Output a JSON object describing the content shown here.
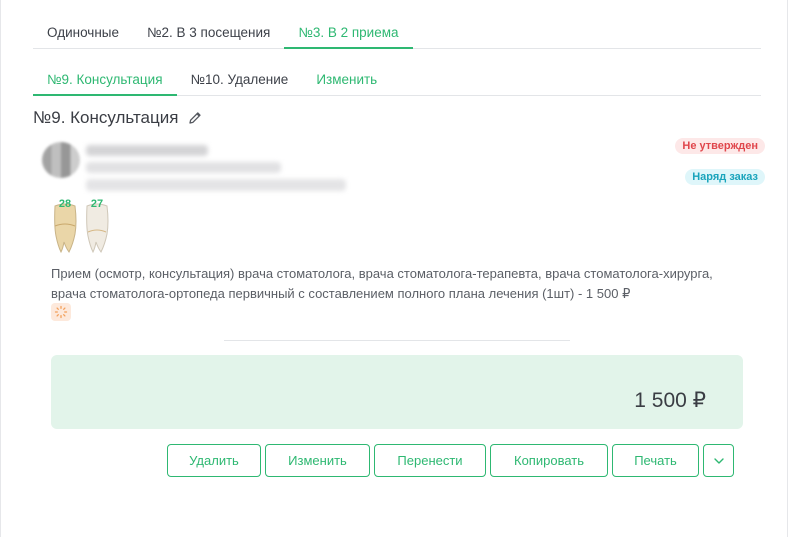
{
  "tabs_top": [
    {
      "label": "Одиночные",
      "active": false
    },
    {
      "label": "№2. В 3 посещения",
      "active": false
    },
    {
      "label": "№3. В 2 приема",
      "active": true
    }
  ],
  "tabs_visit": {
    "consult": "№9. Консультация",
    "removal": "№10. Удаление",
    "edit": "Изменить"
  },
  "plan": {
    "title": "№9. Консультация",
    "status_badge": "Не утвержден",
    "order_badge": "Наряд заказ",
    "teeth": [
      "28",
      "27"
    ],
    "description": "Прием (осмотр, консультация) врача стоматолога, врача стоматолога-терапевта, врача стоматолога-хирурга, врача стоматолога-ортопеда первичный с составлением полного плана лечения (1шт) - 1 500 ₽",
    "total": "1 500 ₽"
  },
  "actions": {
    "delete": "Удалить",
    "edit": "Изменить",
    "move": "Перенести",
    "copy": "Копировать",
    "print": "Печать"
  },
  "colors": {
    "accent": "#2eb872",
    "status_red": "#e0464c",
    "order_cyan": "#1aa4bc",
    "total_bg": "#e2f4ea"
  }
}
